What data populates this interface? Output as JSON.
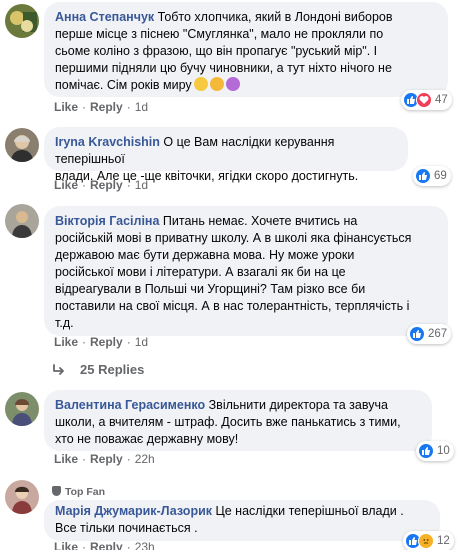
{
  "comments": [
    {
      "author": "Анна Степанчук",
      "lines": [
        "Тобто хлопчика, який в Лондоні виборов",
        "перше місце з піснею \"Смуглянка\", мало не прокляли по",
        "сьоме коліно з фразою, що він пропагує \"руський мір\". І",
        "першими підняли цю бучу чиновники, а тут ніхто нічого не",
        "помічає. Сім років миру"
      ],
      "like": "Like",
      "reply": "Reply",
      "time": "1d",
      "reaction_count": "47",
      "avatar_color": "#6b7a3c"
    },
    {
      "author": "Iryna Kravchishin",
      "lines": [
        "О це Вам наслідки керування теперішньої",
        "влади. Але це -ще квіточки, ягідки скоро достигнуть."
      ],
      "like": "Like",
      "reply": "Reply",
      "time": "1d",
      "reaction_count": "69",
      "avatar_color": "#8a7f6e"
    },
    {
      "author": "Вікторія Гасіліна",
      "lines": [
        "Питань немає. Хочете вчитись на",
        "російській мові в приватну школу. А в школі яка фінансується",
        "державою має бути державна мова. Ну може уроки",
        "російської мови і літератури. А взагалі як би на це",
        "відреагували в Польші чи Угорщині? Там різко все би",
        "поставили на свої місця. А в нас толерантність, терплячість і",
        "т.д."
      ],
      "like": "Like",
      "reply": "Reply",
      "time": "1d",
      "reaction_count": "267",
      "avatar_color": "#a9a59a"
    },
    {
      "author": "Валентина Герасименко",
      "lines": [
        "Звільнити директора та завуча",
        "школи, а вчителям - штраф. Досить вже панькатись з тими,",
        "хто не поважає державну мову!"
      ],
      "like": "Like",
      "reply": "Reply",
      "time": "22h",
      "reaction_count": "10",
      "avatar_color": "#7c8f6a"
    },
    {
      "badge": "Top Fan",
      "author": "Марія Джумарик-Лазорик",
      "lines": [
        "Це наслідки теперішньої влади .",
        "Все тільки починається ."
      ],
      "like": "Like",
      "reply": "Reply",
      "time": "23h",
      "reaction_count": "12",
      "avatar_color": "#c9a8a0"
    }
  ],
  "replies_link": "25 Replies",
  "colors": {
    "author": "#385898",
    "bubble": "#f0f2f5",
    "meta": "#65676b",
    "like": "#1877f2",
    "love": "#f33e58",
    "haha": "#f7b125"
  }
}
